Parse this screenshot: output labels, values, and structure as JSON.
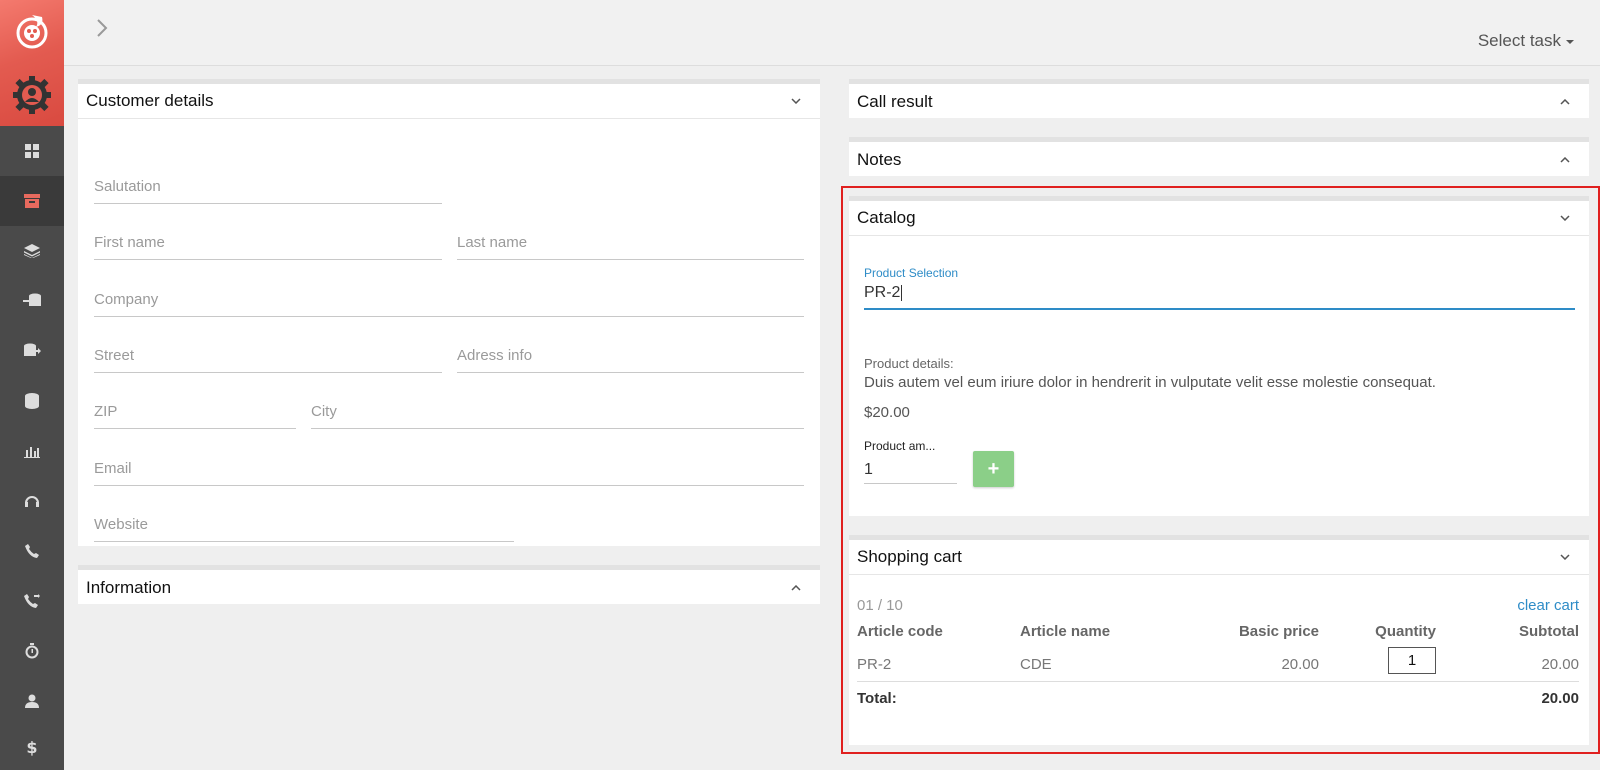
{
  "header": {
    "select_task": "Select task"
  },
  "sidebar": {
    "items": [
      {
        "icon": "dashboard-icon"
      },
      {
        "icon": "archive-icon"
      },
      {
        "icon": "layers-icon"
      },
      {
        "icon": "database-import-icon"
      },
      {
        "icon": "database-export-icon"
      },
      {
        "icon": "database-icon"
      },
      {
        "icon": "bar-chart-icon"
      },
      {
        "icon": "headset-icon"
      },
      {
        "icon": "phone-icon"
      },
      {
        "icon": "phone-forward-icon"
      },
      {
        "icon": "stopwatch-icon"
      },
      {
        "icon": "user-icon"
      },
      {
        "icon": "dollar-icon"
      }
    ]
  },
  "customer": {
    "title": "Customer details",
    "salutation": "Salutation",
    "first_name": "First name",
    "last_name": "Last name",
    "company": "Company",
    "street": "Street",
    "adress_info": "Adress info",
    "zip": "ZIP",
    "city": "City",
    "email": "Email",
    "website": "Website"
  },
  "information": {
    "title": "Information"
  },
  "call_result": {
    "title": "Call result"
  },
  "notes": {
    "title": "Notes"
  },
  "catalog": {
    "title": "Catalog",
    "product_selection_label": "Product Selection",
    "product_selection_value": "PR-2",
    "product_details_label": "Product details:",
    "product_description": "Duis autem vel eum iriure dolor in hendrerit in vulputate velit esse molestie consequat.",
    "price": "$20.00",
    "amount_label": "Product am...",
    "amount_value": "1",
    "add_label": "+"
  },
  "cart": {
    "title": "Shopping cart",
    "count": "01 / 10",
    "clear": "clear cart",
    "columns": [
      "Article code",
      "Article name",
      "Basic price",
      "Quantity",
      "Subtotal"
    ],
    "rows": [
      {
        "code": "PR-2",
        "name": "CDE",
        "price": "20.00",
        "qty": "1",
        "subtotal": "20.00"
      }
    ],
    "total_label": "Total:",
    "total_value": "20.00"
  },
  "colors": {
    "accent": "#2e8cc7",
    "brand": "#e35b50",
    "add_button": "#8bcf88",
    "highlight": "#e0201f"
  }
}
